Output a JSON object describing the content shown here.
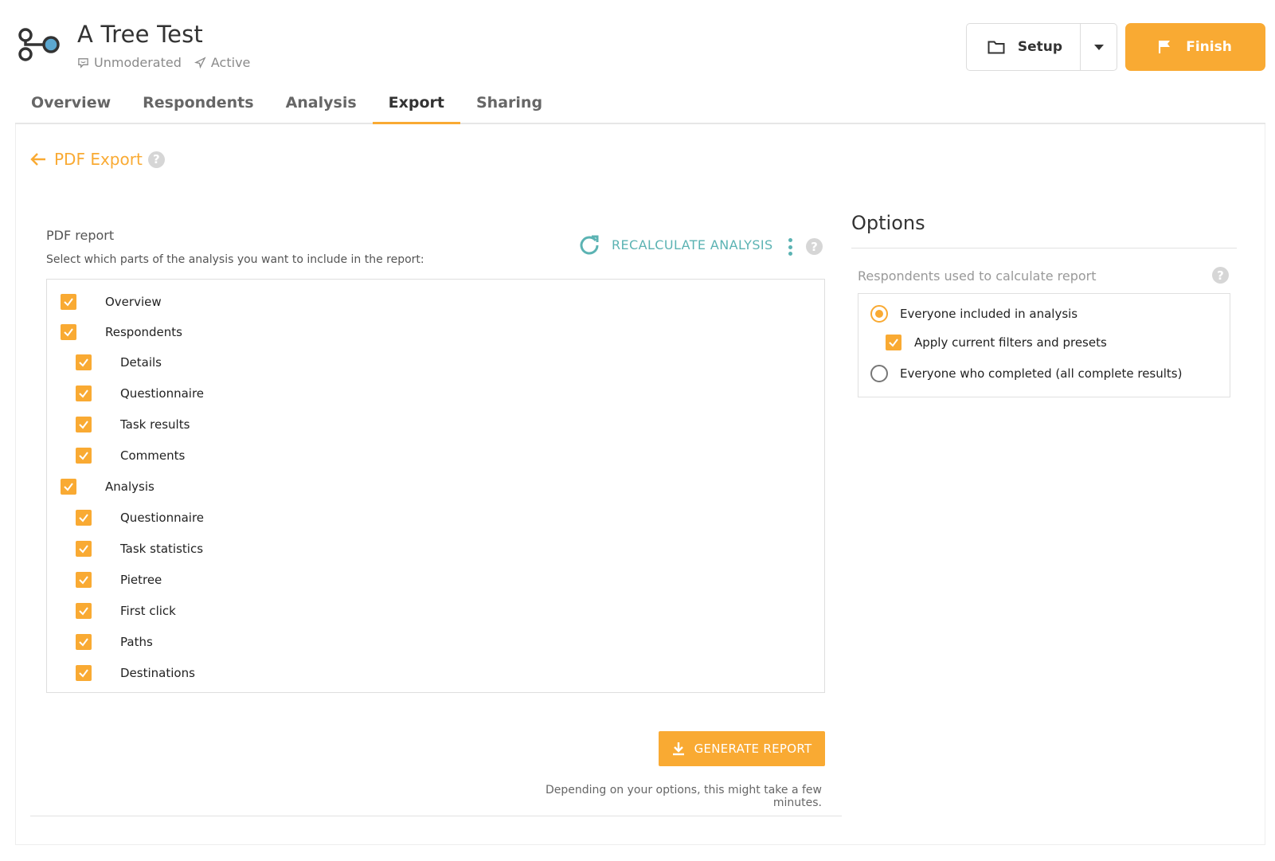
{
  "header": {
    "title": "A Tree Test",
    "mode": "Unmoderated",
    "status": "Active",
    "setup_label": "Setup",
    "finish_label": "Finish"
  },
  "tabs": [
    {
      "label": "Overview",
      "active": false
    },
    {
      "label": "Respondents",
      "active": false
    },
    {
      "label": "Analysis",
      "active": false
    },
    {
      "label": "Export",
      "active": true
    },
    {
      "label": "Sharing",
      "active": false
    }
  ],
  "page": {
    "back_title": "PDF Export"
  },
  "report": {
    "label": "PDF report",
    "subtitle": "Select which parts of the analysis you want to include in the report:",
    "recalculate_label": "RECALCULATE ANALYSIS",
    "items": [
      {
        "label": "Overview",
        "checked": true,
        "level": 0
      },
      {
        "label": "Respondents",
        "checked": true,
        "level": 0
      },
      {
        "label": "Details",
        "checked": true,
        "level": 1
      },
      {
        "label": "Questionnaire",
        "checked": true,
        "level": 1
      },
      {
        "label": "Task results",
        "checked": true,
        "level": 1
      },
      {
        "label": "Comments",
        "checked": true,
        "level": 1
      },
      {
        "label": "Analysis",
        "checked": true,
        "level": 0
      },
      {
        "label": "Questionnaire",
        "checked": true,
        "level": 1
      },
      {
        "label": "Task statistics",
        "checked": true,
        "level": 1
      },
      {
        "label": "Pietree",
        "checked": true,
        "level": 1
      },
      {
        "label": "First click",
        "checked": true,
        "level": 1
      },
      {
        "label": "Paths",
        "checked": true,
        "level": 1
      },
      {
        "label": "Destinations",
        "checked": true,
        "level": 1
      }
    ],
    "generate_label": "GENERATE REPORT",
    "generate_note": "Depending on your options, this might take a few minutes."
  },
  "options": {
    "title": "Options",
    "respondents_label": "Respondents used to calculate report",
    "radio_included": "Everyone included in analysis",
    "apply_filters": "Apply current filters and presets",
    "radio_completed": "Everyone who completed (all complete results)"
  },
  "colors": {
    "accent": "#f9aa33",
    "teal": "#5bb3b3"
  }
}
